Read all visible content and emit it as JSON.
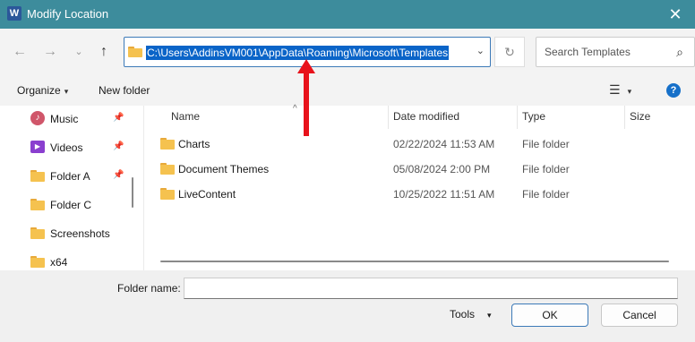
{
  "window": {
    "title": "Modify Location",
    "app_icon_letter": "W",
    "close_glyph": "✕"
  },
  "nav": {
    "back_glyph": "←",
    "forward_glyph": "→",
    "recent_glyph": "⌄",
    "up_glyph": "↑",
    "address_path": "C:\\Users\\AddinsVM001\\AppData\\Roaming\\Microsoft\\Templates",
    "address_dropdown_glyph": "⌄",
    "refresh_glyph": "↻",
    "search_placeholder": "Search Templates",
    "search_glyph": "⌕"
  },
  "toolbar": {
    "organize_label": "Organize",
    "organize_caret": "▾",
    "new_folder_label": "New folder",
    "view_glyph": "☰",
    "view_caret": "▾",
    "help_glyph": "?"
  },
  "sidebar": {
    "items": [
      {
        "label": "Music",
        "icon": "music-icon",
        "pinned": true
      },
      {
        "label": "Videos",
        "icon": "videos-icon",
        "pinned": true
      },
      {
        "label": "Folder A",
        "icon": "folder-icon",
        "pinned": true
      },
      {
        "label": "Folder C",
        "icon": "folder-icon",
        "pinned": false
      },
      {
        "label": "Screenshots",
        "icon": "folder-icon",
        "pinned": false
      },
      {
        "label": "x64",
        "icon": "folder-icon",
        "pinned": false
      }
    ],
    "pin_glyph": "📌"
  },
  "columns": {
    "name": "Name",
    "date_modified": "Date modified",
    "type": "Type",
    "size": "Size",
    "sort_glyph": "^"
  },
  "files": [
    {
      "name": "Charts",
      "date": "02/22/2024 11:53 AM",
      "type": "File folder"
    },
    {
      "name": "Document Themes",
      "date": "05/08/2024 2:00 PM",
      "type": "File folder"
    },
    {
      "name": "LiveContent",
      "date": "10/25/2022 11:51 AM",
      "type": "File folder"
    }
  ],
  "bottom": {
    "folder_name_label": "Folder name:",
    "folder_name_value": "",
    "tools_label": "Tools",
    "tools_caret": "▾",
    "ok_label": "OK",
    "cancel_label": "Cancel"
  },
  "colors": {
    "titlebar": "#3d8c9c",
    "selection": "#0a64c8",
    "annotation_arrow": "#e8121b"
  }
}
